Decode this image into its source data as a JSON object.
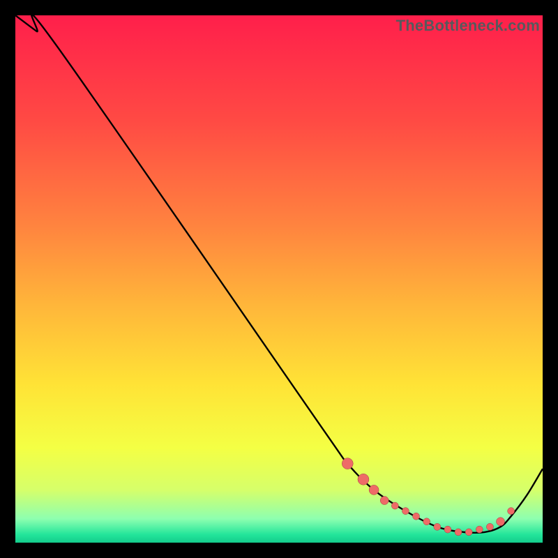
{
  "watermark": "TheBottleneck.com",
  "colors": {
    "bg": "#000000",
    "curve": "#000000",
    "marker_fill": "#ee6b67",
    "marker_stroke": "#9c3f3c"
  },
  "chart_data": {
    "type": "line",
    "title": "",
    "xlabel": "",
    "ylabel": "",
    "xlim": [
      0,
      100
    ],
    "ylim": [
      0,
      100
    ],
    "grid": false,
    "legend": false,
    "gradient_stops": [
      {
        "offset": 0.0,
        "color": "#ff1f4b"
      },
      {
        "offset": 0.2,
        "color": "#ff4a44"
      },
      {
        "offset": 0.4,
        "color": "#ff843f"
      },
      {
        "offset": 0.55,
        "color": "#ffb63a"
      },
      {
        "offset": 0.7,
        "color": "#ffe336"
      },
      {
        "offset": 0.82,
        "color": "#f4ff44"
      },
      {
        "offset": 0.9,
        "color": "#d6ff6a"
      },
      {
        "offset": 0.955,
        "color": "#8dffb0"
      },
      {
        "offset": 0.985,
        "color": "#22e59a"
      },
      {
        "offset": 1.0,
        "color": "#14cc8c"
      }
    ],
    "series": [
      {
        "name": "bottleneck-curve",
        "x": [
          0,
          4,
          8,
          58,
          63,
          68,
          74,
          80,
          85,
          89,
          92,
          94,
          97,
          100
        ],
        "y": [
          100,
          97,
          94,
          22,
          15,
          10,
          6,
          3,
          2,
          2,
          3,
          5,
          9,
          14
        ]
      }
    ],
    "markers": {
      "name": "highlighted-range",
      "x": [
        63,
        66,
        68,
        70,
        72,
        74,
        76,
        78,
        80,
        82,
        84,
        86,
        88,
        90,
        92,
        94
      ],
      "y": [
        15,
        12,
        10,
        8,
        7,
        6,
        5,
        4,
        3,
        2.5,
        2,
        2,
        2.5,
        3,
        4,
        6
      ],
      "r": [
        8,
        8,
        7,
        6,
        5,
        5,
        5,
        5,
        5,
        5,
        5,
        5,
        5,
        5,
        6,
        5
      ]
    }
  }
}
